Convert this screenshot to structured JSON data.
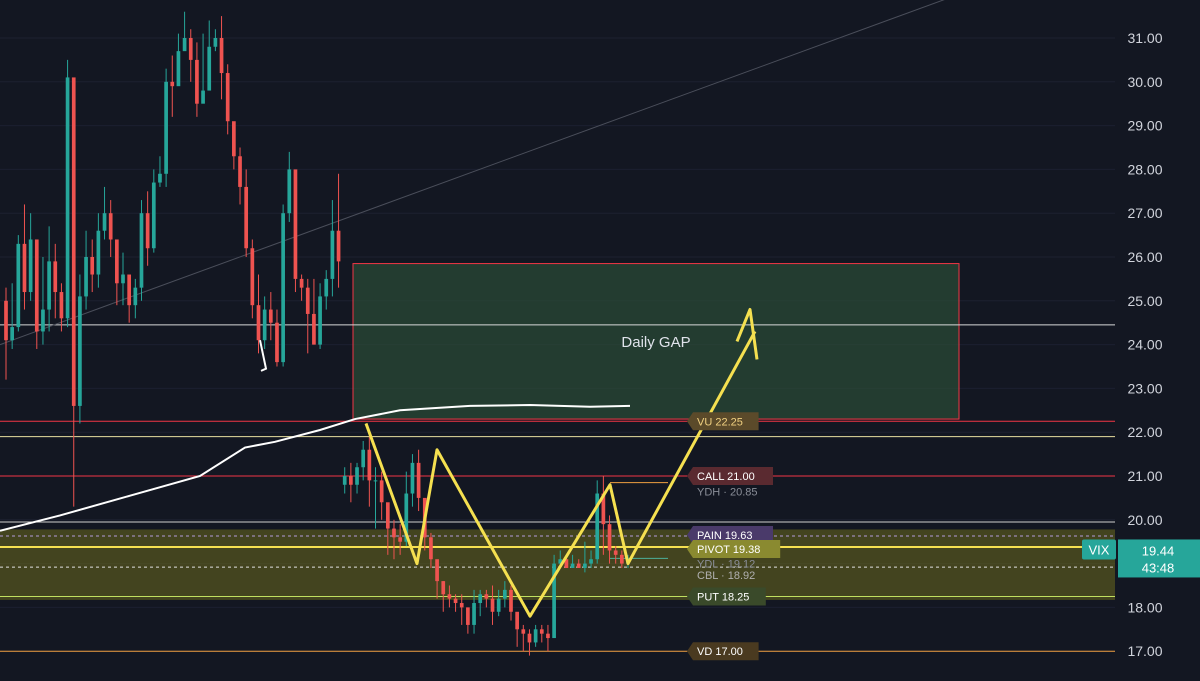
{
  "chart_data": {
    "type": "candlestick",
    "symbol": "VIX",
    "last_price": "19.44",
    "countdown": "43:48",
    "ylim": [
      16.7,
      31.8
    ],
    "y_ticks": [
      "31.00",
      "30.00",
      "29.00",
      "28.00",
      "27.00",
      "26.00",
      "25.00",
      "24.00",
      "23.00",
      "22.00",
      "21.00",
      "20.00",
      "19.00",
      "18.00",
      "17.00"
    ],
    "candles": [
      [
        25.0,
        24.1,
        25.3,
        23.2
      ],
      [
        24.1,
        24.4,
        25.4,
        23.9
      ],
      [
        24.4,
        26.3,
        26.5,
        24.3
      ],
      [
        26.3,
        25.2,
        27.2,
        24.8
      ],
      [
        25.2,
        26.4,
        27.0,
        25.0
      ],
      [
        26.4,
        24.3,
        25.3,
        23.9
      ],
      [
        24.3,
        24.8,
        26.0,
        24.0
      ],
      [
        24.8,
        25.9,
        26.7,
        24.3
      ],
      [
        25.9,
        25.2,
        26.3,
        24.6
      ],
      [
        25.2,
        24.6,
        25.4,
        24.3
      ],
      [
        24.6,
        30.1,
        30.5,
        24.4
      ],
      [
        30.1,
        22.6,
        25.5,
        20.3
      ],
      [
        22.6,
        25.1,
        25.6,
        22.2
      ],
      [
        25.1,
        26.0,
        26.6,
        24.8
      ],
      [
        26.0,
        25.6,
        26.4,
        25.2
      ],
      [
        25.6,
        26.6,
        27.0,
        25.3
      ],
      [
        26.6,
        27.0,
        27.6,
        26.4
      ],
      [
        27.0,
        26.4,
        27.3,
        26.0
      ],
      [
        26.4,
        25.4,
        26.0,
        24.9
      ],
      [
        25.4,
        25.6,
        26.1,
        24.9
      ],
      [
        25.6,
        24.9,
        25.3,
        24.5
      ],
      [
        24.9,
        25.3,
        25.5,
        24.6
      ],
      [
        25.3,
        27.0,
        27.3,
        25.0
      ],
      [
        27.0,
        26.2,
        27.5,
        25.8
      ],
      [
        26.2,
        27.7,
        28.0,
        26.1
      ],
      [
        27.7,
        27.9,
        28.3,
        27.6
      ],
      [
        27.9,
        30.0,
        30.3,
        27.6
      ],
      [
        30.0,
        29.9,
        30.6,
        29.2
      ],
      [
        29.9,
        30.7,
        31.1,
        30.5
      ],
      [
        30.7,
        31.0,
        31.6,
        30.8
      ],
      [
        31.0,
        30.5,
        31.2,
        30.0
      ],
      [
        30.5,
        29.5,
        30.9,
        29.2
      ],
      [
        29.5,
        29.8,
        31.1,
        29.6
      ],
      [
        29.8,
        30.8,
        31.4,
        30.1
      ],
      [
        30.8,
        31.0,
        31.2,
        30.7
      ],
      [
        31.0,
        30.2,
        31.5,
        29.6
      ],
      [
        30.2,
        29.1,
        30.4,
        28.8
      ],
      [
        29.1,
        28.3,
        29.0,
        28.0
      ],
      [
        28.3,
        27.6,
        28.5,
        27.2
      ],
      [
        27.6,
        26.2,
        28.0,
        26.0
      ],
      [
        26.2,
        24.9,
        26.4,
        24.6
      ],
      [
        24.9,
        24.1,
        25.6,
        23.8
      ],
      [
        24.1,
        24.8,
        25.1,
        23.9
      ],
      [
        24.8,
        24.5,
        25.2,
        24.1
      ],
      [
        24.5,
        23.6,
        24.8,
        23.5
      ],
      [
        23.6,
        27.0,
        27.2,
        23.5
      ],
      [
        27.0,
        28.0,
        28.4,
        26.8
      ],
      [
        28.0,
        25.5,
        26.7,
        25.2
      ],
      [
        25.5,
        25.3,
        25.6,
        25.0
      ],
      [
        25.3,
        24.7,
        25.5,
        23.8
      ],
      [
        24.7,
        24.0,
        25.5,
        24.0
      ],
      [
        24.0,
        25.1,
        25.4,
        23.9
      ],
      [
        25.1,
        25.5,
        25.7,
        24.8
      ],
      [
        25.5,
        26.6,
        27.3,
        25.1
      ],
      [
        26.6,
        25.9,
        27.9,
        25.3
      ],
      [
        20.8,
        21.0,
        21.2,
        20.6
      ],
      [
        21.0,
        20.8,
        21.3,
        20.4
      ],
      [
        20.8,
        21.2,
        21.3,
        20.6
      ],
      [
        21.2,
        21.6,
        21.8,
        20.9
      ],
      [
        21.6,
        20.9,
        21.9,
        20.3
      ],
      [
        20.9,
        20.9,
        21.2,
        19.8
      ],
      [
        20.9,
        20.4,
        21.1,
        20.0
      ],
      [
        20.4,
        19.8,
        20.2,
        19.2
      ],
      [
        19.8,
        19.6,
        20.0,
        19.1
      ],
      [
        19.6,
        19.5,
        19.9,
        19.2
      ],
      [
        19.5,
        20.6,
        21.1,
        19.4
      ],
      [
        20.6,
        21.3,
        21.5,
        20.3
      ],
      [
        21.3,
        20.5,
        21.6,
        20.2
      ],
      [
        20.5,
        19.6,
        20.4,
        19.3
      ],
      [
        19.6,
        19.1,
        19.7,
        18.9
      ],
      [
        19.1,
        18.6,
        19.0,
        18.2
      ],
      [
        18.6,
        18.3,
        18.6,
        17.9
      ],
      [
        18.3,
        18.2,
        18.5,
        18.0
      ],
      [
        18.2,
        18.1,
        18.3,
        17.9
      ],
      [
        18.1,
        18.0,
        18.3,
        17.6
      ],
      [
        18.0,
        17.6,
        18.0,
        17.4
      ],
      [
        17.6,
        18.1,
        18.4,
        17.4
      ],
      [
        18.1,
        18.3,
        18.4,
        17.8
      ],
      [
        18.3,
        18.2,
        18.4,
        18.0
      ],
      [
        18.2,
        17.9,
        18.5,
        17.6
      ],
      [
        17.9,
        18.2,
        18.4,
        17.8
      ],
      [
        18.2,
        18.4,
        18.6,
        18.0
      ],
      [
        18.4,
        17.9,
        18.5,
        17.7
      ],
      [
        17.9,
        17.5,
        17.8,
        17.1
      ],
      [
        17.5,
        17.4,
        17.6,
        17.0
      ],
      [
        17.4,
        17.2,
        17.5,
        16.9
      ],
      [
        17.2,
        17.5,
        17.6,
        17.1
      ],
      [
        17.5,
        17.4,
        17.6,
        17.2
      ],
      [
        17.4,
        17.3,
        17.6,
        17.0
      ],
      [
        17.3,
        19.0,
        19.2,
        18.9
      ],
      [
        19.0,
        19.1,
        19.3,
        18.9
      ],
      [
        19.1,
        18.9,
        19.2,
        18.9
      ],
      [
        18.9,
        19.0,
        19.2,
        18.9
      ],
      [
        19.0,
        18.9,
        19.1,
        18.9
      ],
      [
        18.9,
        19.0,
        19.5,
        18.8
      ],
      [
        19.0,
        19.1,
        19.3,
        18.9
      ],
      [
        19.1,
        20.6,
        20.9,
        19.0
      ],
      [
        20.6,
        19.9,
        21.0,
        19.2
      ],
      [
        19.9,
        19.3,
        20.1,
        19.0
      ],
      [
        19.3,
        19.2,
        19.4,
        19.0
      ],
      [
        19.2,
        19.0,
        19.3,
        18.9
      ],
      [
        19.0,
        19.1,
        19.2,
        18.9
      ]
    ],
    "ma_line": [
      [
        0,
        19.75
      ],
      [
        60,
        20.1
      ],
      [
        130,
        20.55
      ],
      [
        200,
        21.0
      ],
      [
        245,
        21.65
      ],
      [
        275,
        21.78
      ],
      [
        320,
        22.05
      ],
      [
        355,
        22.3
      ],
      [
        400,
        22.5
      ],
      [
        470,
        22.6
      ],
      [
        530,
        22.62
      ],
      [
        590,
        22.58
      ],
      [
        630,
        22.6
      ]
    ],
    "trendline": [
      [
        0,
        24.0
      ],
      [
        1115,
        33.3
      ]
    ],
    "zigzag": [
      [
        366,
        22.2
      ],
      [
        417,
        19.0
      ],
      [
        437,
        21.6
      ],
      [
        530,
        17.8
      ],
      [
        610,
        20.8
      ],
      [
        628,
        19.0
      ],
      [
        755,
        24.3
      ]
    ],
    "gap_zone": {
      "label": "Daily GAP",
      "top": 25.85,
      "bottom": 22.3
    },
    "white_hline": 24.45,
    "yellow_zone": {
      "top": 19.78,
      "bottom": 18.17
    },
    "levels": [
      {
        "label": "VU 22.25",
        "price": 22.25,
        "color": "#f23645",
        "tag_bg": "#5b4a2a",
        "tag_fg": "#f0d080"
      },
      {
        "label": "CALL 21.00",
        "price": 21.0,
        "color": "#f23645",
        "tag_bg": "#5a2a30",
        "tag_fg": "#ffffff"
      },
      {
        "label": "YDH · 20.85",
        "price": 20.85,
        "color": "#f0a040",
        "tag_bg": "none",
        "tag_fg": "#8a8e98"
      },
      {
        "label": "PAIN 19.63",
        "price": 19.63,
        "color": "#b39ddb",
        "tag_bg": "#4a3a6a",
        "tag_fg": "#ffffff"
      },
      {
        "label": "PIVOT 19.38",
        "price": 19.38,
        "color": "#f5e050",
        "tag_bg": "#8a8a30",
        "tag_fg": "#ffffff"
      },
      {
        "label": "YDL · 19.12",
        "price": 19.12,
        "color": "#4caf9a",
        "tag_bg": "none",
        "tag_fg": "#8a8e98"
      },
      {
        "label": "CBL · 18.92",
        "price": 18.92,
        "color": "#e0e0e0",
        "tag_bg": "none",
        "tag_fg": "#b0b0b0"
      },
      {
        "label": "PUT 18.25",
        "price": 18.25,
        "color": "#c0e060",
        "tag_bg": "#3a4a2a",
        "tag_fg": "#ffffff"
      },
      {
        "label": "VD 17.00",
        "price": 17.0,
        "color": "#f0a040",
        "tag_bg": "#4a3a20",
        "tag_fg": "#ffffff"
      }
    ]
  },
  "colors": {
    "background": "#131722",
    "bull": "#26a69a",
    "bear": "#ef5350",
    "ma": "#ffffff",
    "zigzag": "#f5e050",
    "gap_fill": "#2a4a36",
    "gap_border": "#f23645",
    "price_tag": "#26a69a"
  }
}
